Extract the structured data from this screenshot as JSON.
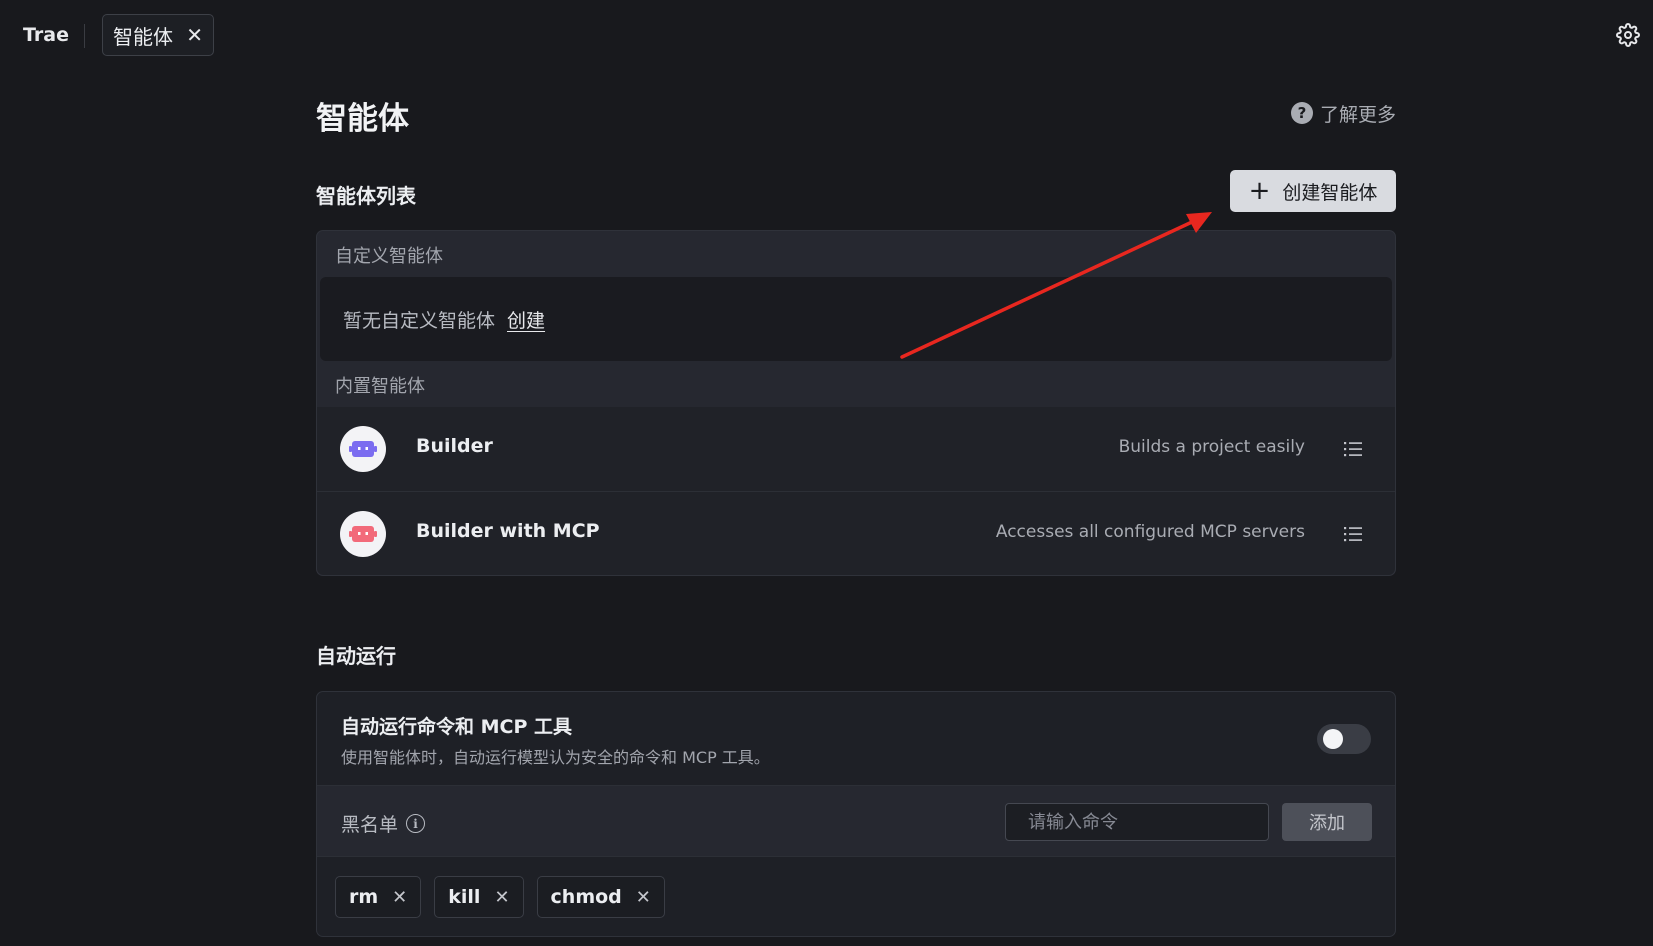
{
  "topbar": {
    "app_title": "Trae",
    "tab_label": "智能体",
    "tab_close": "✕",
    "settings_icon": "gear-icon"
  },
  "header": {
    "title": "智能体",
    "learn_more": "了解更多",
    "help_glyph": "?"
  },
  "agents": {
    "section_title": "智能体列表",
    "create_button": "创建智能体",
    "create_plus": "+",
    "custom_group_label": "自定义智能体",
    "empty_text": "暂无自定义智能体",
    "empty_create_link": "创建",
    "builtin_group_label": "内置智能体",
    "builtin": [
      {
        "name": "Builder",
        "description": "Builds a project easily",
        "avatar_color": "#7b6cf0",
        "icon": "robot-icon"
      },
      {
        "name": "Builder with MCP",
        "description": "Accesses all configured MCP servers",
        "avatar_color": "#f26a7a",
        "icon": "robot-icon"
      }
    ]
  },
  "auto_run": {
    "section_title": "自动运行",
    "title": "自动运行命令和 MCP 工具",
    "description": "使用智能体时，自动运行模型认为安全的命令和 MCP 工具。",
    "toggle_on": false,
    "blacklist_label": "黑名单",
    "info_glyph": "i",
    "input_placeholder": "请输入命令",
    "add_button": "添加",
    "chip_remove": "✕",
    "blacklist": [
      "rm",
      "kill",
      "chmod"
    ]
  },
  "colors": {
    "background": "#18191d",
    "annotation_arrow": "#e8271f"
  }
}
